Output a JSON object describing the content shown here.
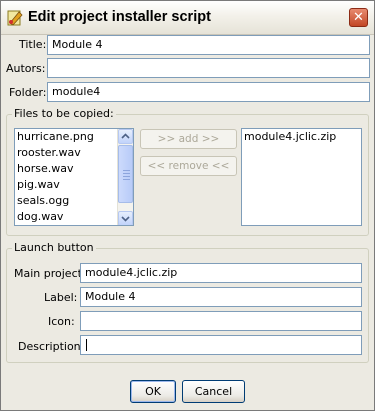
{
  "window": {
    "title": "Edit project installer script"
  },
  "form": {
    "title": {
      "label": "Title:",
      "value": "Module 4"
    },
    "authors": {
      "label": "Autors:",
      "value": ""
    },
    "folder": {
      "label": "Folder:",
      "value": "module4"
    }
  },
  "files_group": {
    "legend": "Files to be copied:",
    "available": [
      "hurricane.png",
      "rooster.wav",
      "horse.wav",
      "pig.wav",
      "seals.ogg",
      "dog.wav"
    ],
    "add_label": ">> add >>",
    "remove_label": "<< remove <<",
    "selected": [
      "module4.jclic.zip"
    ]
  },
  "launch_group": {
    "legend": "Launch button",
    "main_project": {
      "label": "Main project:",
      "value": "module4.jclic.zip"
    },
    "label": {
      "label": "Label:",
      "value": "Module 4"
    },
    "icon": {
      "label": "Icon:",
      "value": ""
    },
    "description": {
      "label": "Description",
      "value": ""
    }
  },
  "buttons": {
    "ok": "OK",
    "cancel": "Cancel"
  },
  "colors": {
    "title_bar": "#f3f1ea",
    "dialog_bg": "#eceae2",
    "close_button": "#c24726",
    "field_border": "#7f9db9",
    "scrollbar": "#c1d3fb"
  }
}
